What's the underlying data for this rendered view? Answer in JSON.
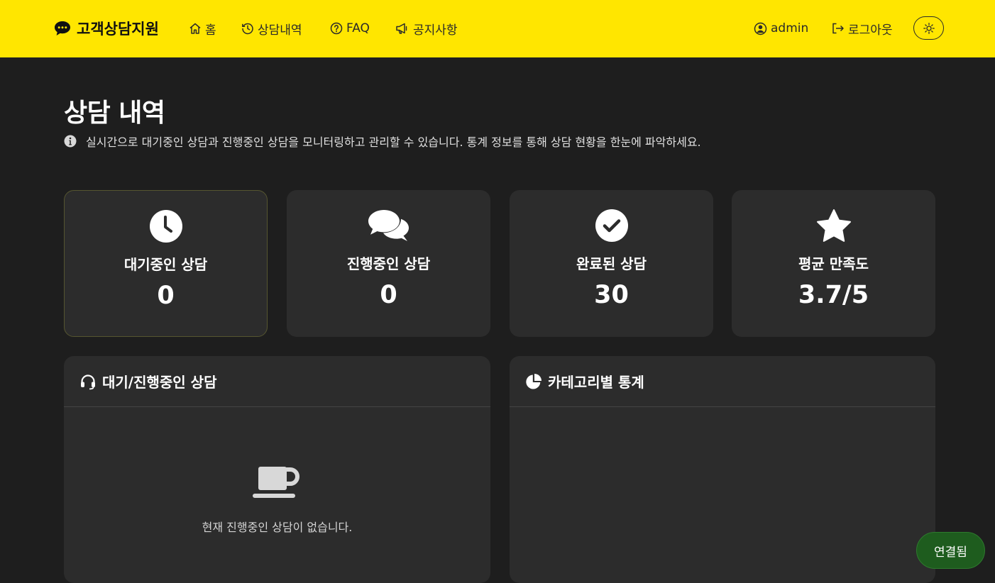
{
  "brand": {
    "name": "고객상담지원",
    "icon": "chat-bubble-icon"
  },
  "nav": {
    "items": [
      {
        "label": "홈",
        "icon": "home-icon"
      },
      {
        "label": "상담내역",
        "icon": "history-icon"
      },
      {
        "label": "FAQ",
        "icon": "question-circle-icon"
      },
      {
        "label": "공지사항",
        "icon": "megaphone-icon"
      }
    ],
    "user": {
      "label": "admin",
      "icon": "user-circle-icon"
    },
    "logout": {
      "label": "로그아웃",
      "icon": "logout-icon"
    },
    "theme_toggle": {
      "icon": "sun-icon"
    }
  },
  "header": {
    "title": "상담 내역",
    "description": "실시간으로 대기중인 상담과 진행중인 상담을 모니터링하고 관리할 수 있습니다. 통계 정보를 통해 상담 현황을 한눈에 파악하세요."
  },
  "stats": [
    {
      "label": "대기중인 상담",
      "value": "0",
      "icon": "clock-icon"
    },
    {
      "label": "진행중인 상담",
      "value": "0",
      "icon": "chat-bubbles-icon"
    },
    {
      "label": "완료된 상담",
      "value": "30",
      "icon": "check-circle-icon"
    },
    {
      "label": "평균 만족도",
      "value": "3.7/5",
      "icon": "star-icon"
    }
  ],
  "panels": {
    "active": {
      "title": "대기/진행중인 상담",
      "icon": "headset-icon",
      "empty_text": "현재 진행중인 상담이 없습니다.",
      "empty_icon": "coffee-cup-icon"
    },
    "category": {
      "title": "카테고리별 통계",
      "icon": "pie-chart-icon"
    }
  },
  "connection": {
    "status": "연결됨",
    "color": "#1e5c1e"
  },
  "colors": {
    "accent": "#ffe600",
    "background": "#1e1e1e",
    "card": "#2c2c2c"
  }
}
